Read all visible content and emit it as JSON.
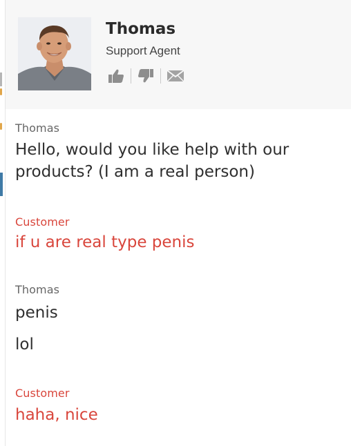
{
  "agent": {
    "name": "Thomas",
    "role": "Support Agent",
    "actions": [
      {
        "icon": "thumbs-up-icon"
      },
      {
        "icon": "thumbs-down-icon"
      },
      {
        "icon": "envelope-icon"
      }
    ]
  },
  "conversation": [
    {
      "sender": "Thomas",
      "role": "agent",
      "lines": [
        "Hello, would you like help with our",
        "products? (I am a real person)"
      ]
    },
    {
      "sender": "Customer",
      "role": "customer",
      "lines": [
        "if u are real type penis"
      ]
    },
    {
      "sender": "Thomas",
      "role": "agent",
      "lines": [
        "penis",
        "lol"
      ]
    },
    {
      "sender": "Customer",
      "role": "customer",
      "lines": [
        "haha, nice"
      ]
    }
  ],
  "colors": {
    "header_bg": "#f7f7f7",
    "agent_text": "#2f2f2f",
    "customer_text": "#d9463c",
    "icon_gray": "#8e8e8e"
  }
}
